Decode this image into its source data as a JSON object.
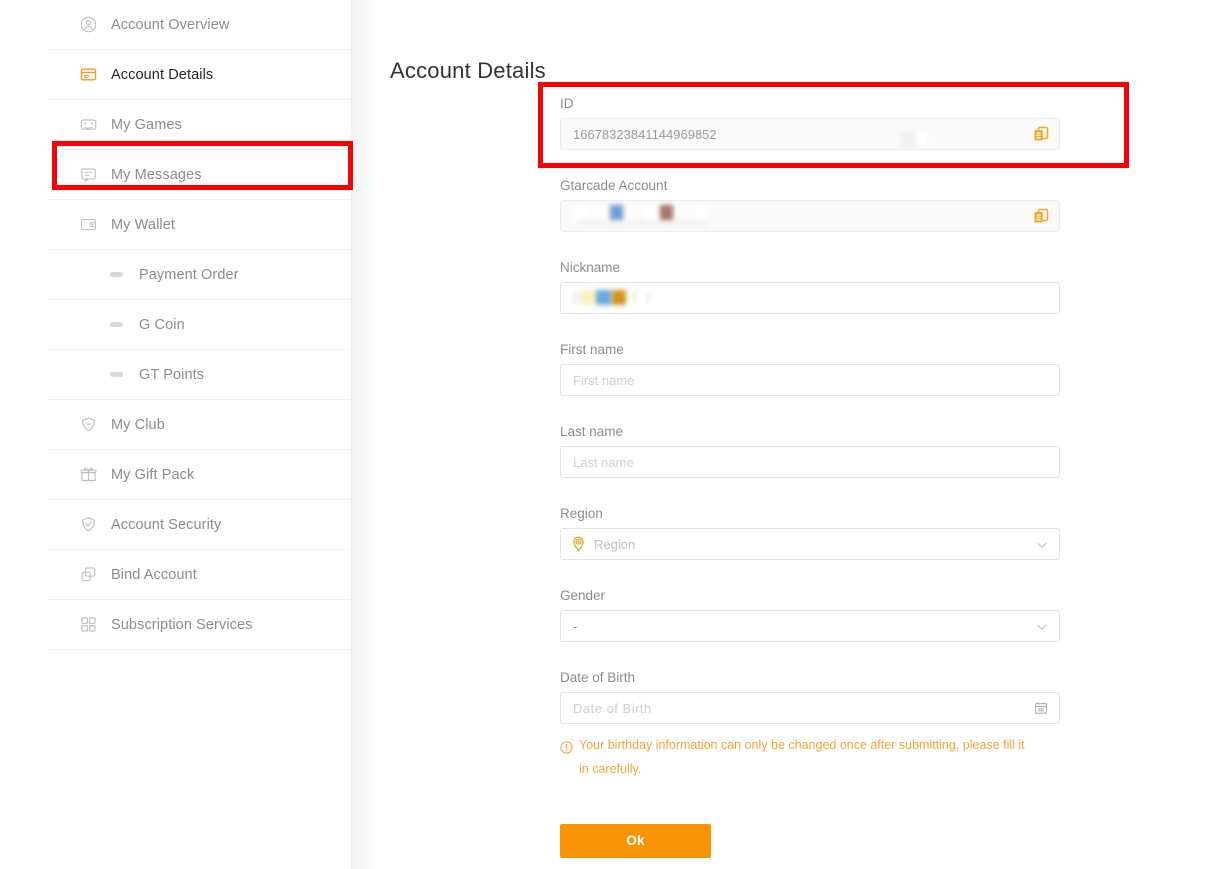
{
  "page": {
    "title": "Account Details"
  },
  "sidebar": {
    "items": [
      {
        "label": "Account Overview",
        "icon": "user-circle-icon",
        "active": false,
        "sub": false
      },
      {
        "label": "Account Details",
        "icon": "id-card-icon",
        "active": true,
        "sub": false
      },
      {
        "label": "My Games",
        "icon": "gamepad-icon",
        "active": false,
        "sub": false
      },
      {
        "label": "My Messages",
        "icon": "message-icon",
        "active": false,
        "sub": false
      },
      {
        "label": "My Wallet",
        "icon": "wallet-icon",
        "active": false,
        "sub": false
      },
      {
        "label": "Payment Order",
        "icon": "dash-icon",
        "active": false,
        "sub": true
      },
      {
        "label": "G Coin",
        "icon": "dash-icon",
        "active": false,
        "sub": true
      },
      {
        "label": "GT Points",
        "icon": "dash-icon",
        "active": false,
        "sub": true
      },
      {
        "label": "My Club",
        "icon": "club-shield-icon",
        "active": false,
        "sub": false
      },
      {
        "label": "My Gift Pack",
        "icon": "gift-icon",
        "active": false,
        "sub": false
      },
      {
        "label": "Account Security",
        "icon": "shield-check-icon",
        "active": false,
        "sub": false
      },
      {
        "label": "Bind Account",
        "icon": "link-squares-icon",
        "active": false,
        "sub": false
      },
      {
        "label": "Subscription Services",
        "icon": "grid-squares-icon",
        "active": false,
        "sub": false
      }
    ]
  },
  "form": {
    "id": {
      "label": "ID",
      "value": "16678323841144969852",
      "copy_icon": "copy-icon",
      "readonly": true
    },
    "gtarcade_account": {
      "label": "Gtarcade Account",
      "value": "",
      "masked": true,
      "copy_icon": "copy-icon",
      "readonly": true
    },
    "nickname": {
      "label": "Nickname",
      "value": "",
      "masked": true
    },
    "first_name": {
      "label": "First name",
      "value": "",
      "placeholder": "First name"
    },
    "last_name": {
      "label": "Last name",
      "value": "",
      "placeholder": "Last name"
    },
    "region": {
      "label": "Region",
      "value": "Region",
      "icon": "location-pin-icon",
      "chevron_icon": "chevron-down-icon"
    },
    "gender": {
      "label": "Gender",
      "value": "-",
      "chevron_icon": "chevron-down-icon"
    },
    "date_of_birth": {
      "label": "Date of Birth",
      "value": "",
      "placeholder": "Date of Birth",
      "icon": "calendar-icon"
    },
    "warning": {
      "icon": "exclamation-circle-icon",
      "text": "Your birthday information can only be changed once after submitting, please fill it in carefully."
    },
    "submit": {
      "label": "Ok"
    }
  },
  "annotations": [
    {
      "name": "sidebar-active-highlight",
      "color": "#fb0007"
    },
    {
      "name": "id-field-highlight",
      "color": "#fb0007"
    }
  ],
  "colors": {
    "accent_orange": "#f89406",
    "copy_icon_orange": "#f5a623",
    "warning_orange": "#f7a335",
    "annotation_red": "#fb0007",
    "text_muted": "#8c8c8c",
    "text_dark": "#333333"
  }
}
